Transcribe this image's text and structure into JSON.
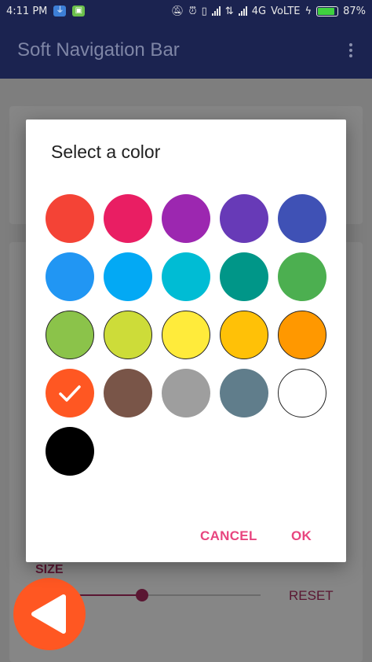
{
  "status_bar": {
    "time": "4:11 PM",
    "network": "4G",
    "volte": "VoLTE",
    "battery_percent": "87%",
    "battery_level": 0.87
  },
  "app_bar": {
    "title": "Soft Navigation Bar"
  },
  "background": {
    "size_label": "SIZE",
    "reset_label": "RESET",
    "slider_value": 0.35
  },
  "dialog": {
    "title": "Select a color",
    "cancel_label": "CANCEL",
    "ok_label": "OK",
    "selected_index": 15,
    "swatches": [
      "#f44336",
      "#e91e63",
      "#9c27b0",
      "#673ab7",
      "#3f51b5",
      "#2196f3",
      "#03a9f4",
      "#00bcd4",
      "#009688",
      "#4caf50",
      "#8bc34a",
      "#cddc39",
      "#ffeb3b",
      "#ffc107",
      "#ff9800",
      "#ff5722",
      "#795548",
      "#9e9e9e",
      "#607d8b",
      "#ffffff",
      "#000000"
    ],
    "outlined": [
      10,
      11,
      12,
      13,
      14,
      19
    ]
  },
  "colors": {
    "accent": "#e8457f",
    "app_bar": "#1b2350",
    "nav_button": "#ff5722"
  }
}
